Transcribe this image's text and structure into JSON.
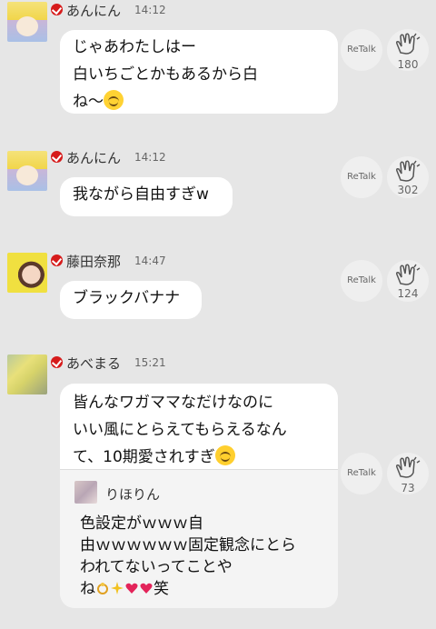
{
  "messages": [
    {
      "name": "あんにん",
      "time": "14:12",
      "lines": [
        "じゃあわたしはー",
        "白いちごとかもあるから白",
        "ね〜"
      ],
      "retalk": "ReTalk",
      "claps": "180"
    },
    {
      "name": "あんにん",
      "time": "14:12",
      "lines": [
        "我ながら自由すぎw"
      ],
      "retalk": "ReTalk",
      "claps": "302"
    },
    {
      "name": "藤田奈那",
      "time": "14:47",
      "lines": [
        "ブラックバナナ"
      ],
      "retalk": "ReTalk",
      "claps": "124"
    },
    {
      "name": "あべまる",
      "time": "15:21",
      "lines": [
        "皆んなワガママなだけなのに",
        "いい風にとらえてもらえるなん",
        "て、10期愛されすぎ"
      ],
      "retalk": "ReTalk",
      "claps": "73",
      "quote": {
        "name": "りほりん",
        "lines": [
          "色設定がｗｗｗ自",
          "由ｗｗｗｗｗｗ固定観念にとら",
          "われてないってことや",
          "ね",
          "笑"
        ]
      }
    }
  ],
  "icons": {
    "verified": "verified-check-icon",
    "clap": "clap-hands-icon",
    "emoji_smile": "smiling-face-emoji",
    "emoji_cry": "crying-laughing-emoji"
  },
  "colors": {
    "verified": "#d61b1b",
    "bubble": "#ffffff",
    "background": "#e6e6e6"
  }
}
